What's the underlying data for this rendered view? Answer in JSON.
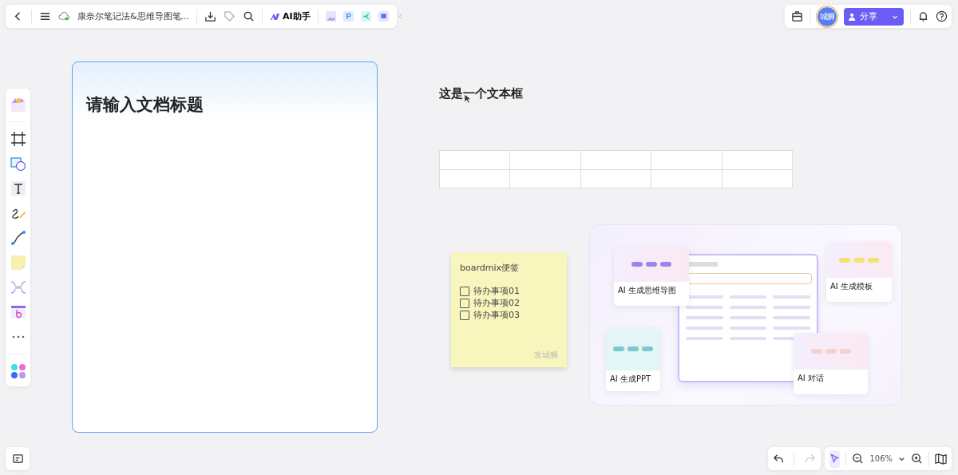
{
  "toolbar": {
    "doc_title": "康奈尔笔记法&思维导图笔...",
    "ai_label": "AI助手"
  },
  "top_right": {
    "avatar": "城狮",
    "share": "分享"
  },
  "frame": {
    "title": "请输入文档标题"
  },
  "text_box": "这是一个文本框",
  "sticky": {
    "title": "boardmix便签",
    "items": [
      {
        "label": "待办事项01",
        "checked": false
      },
      {
        "label": "待办事项02",
        "checked": false
      },
      {
        "label": "待办事项03",
        "checked": false
      }
    ],
    "author": "攻城狮"
  },
  "promo": {
    "cards": [
      "AI 生成思维导图",
      "AI 生成模板",
      "AI 生成PPT",
      "AI 对话"
    ]
  },
  "zoom": "106%"
}
